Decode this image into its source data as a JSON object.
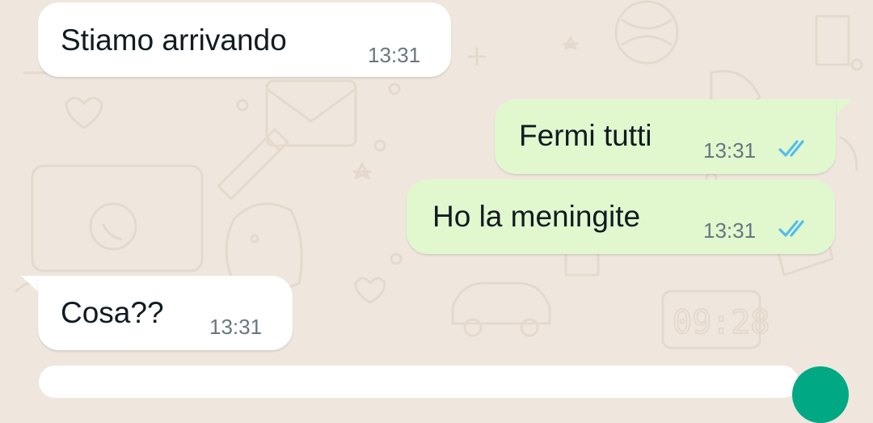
{
  "colors": {
    "background": "#EFE7DE",
    "incoming_bubble": "#FFFFFF",
    "outgoing_bubble": "#E1F8CF",
    "read_ticks": "#53BDEB",
    "timestamp": "#667781",
    "accent": "#00A884"
  },
  "messages": [
    {
      "direction": "incoming",
      "text": "Stiamo arrivando",
      "time": "13:31"
    },
    {
      "direction": "outgoing",
      "text": "Fermi tutti",
      "time": "13:31",
      "status": "read",
      "status_icon": "double-check-icon"
    },
    {
      "direction": "outgoing",
      "text": "Ho la meningite",
      "time": "13:31",
      "status": "read",
      "status_icon": "double-check-icon"
    },
    {
      "direction": "incoming",
      "text": "Cosa??",
      "time": "13:31"
    }
  ]
}
